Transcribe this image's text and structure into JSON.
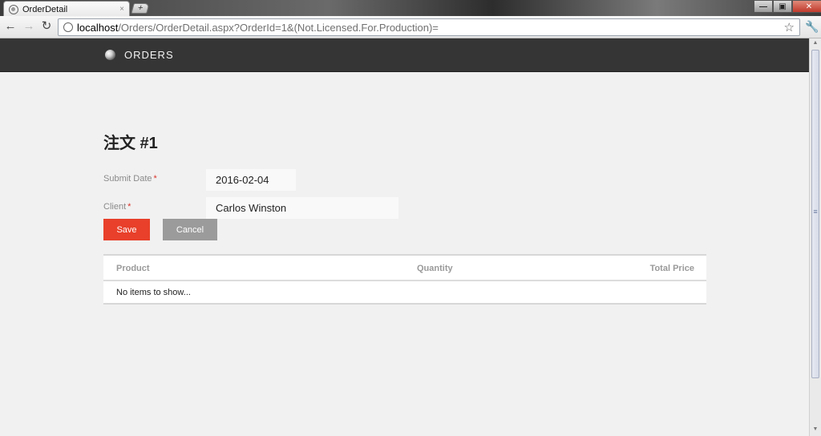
{
  "browser": {
    "tab_title": "OrderDetail",
    "tab_close": "×",
    "new_tab": "+",
    "url_host": "localhost",
    "url_path": "/Orders/OrderDetail.aspx?OrderId=1&(Not.Licensed.For.Production)="
  },
  "app": {
    "brand": "ORDERS"
  },
  "order": {
    "title": "注文 #1",
    "submit_date_label": "Submit Date",
    "submit_date_value": "2016-02-04",
    "client_label": "Client",
    "client_value": "Carlos Winston",
    "required_mark": "*"
  },
  "actions": {
    "save_label": "Save",
    "cancel_label": "Cancel"
  },
  "items_grid": {
    "columns": [
      "Product",
      "Quantity",
      "Total Price"
    ],
    "empty_text": "No items to show..."
  },
  "colors": {
    "header_bg": "#353535",
    "save_button": "#e8402a",
    "cancel_button": "#9b9b9b",
    "required_mark": "#d9342b"
  },
  "icons": [
    "globe-icon",
    "back-arrow-icon",
    "forward-arrow-icon",
    "reload-icon",
    "star-icon",
    "wrench-icon",
    "logo-icon"
  ]
}
